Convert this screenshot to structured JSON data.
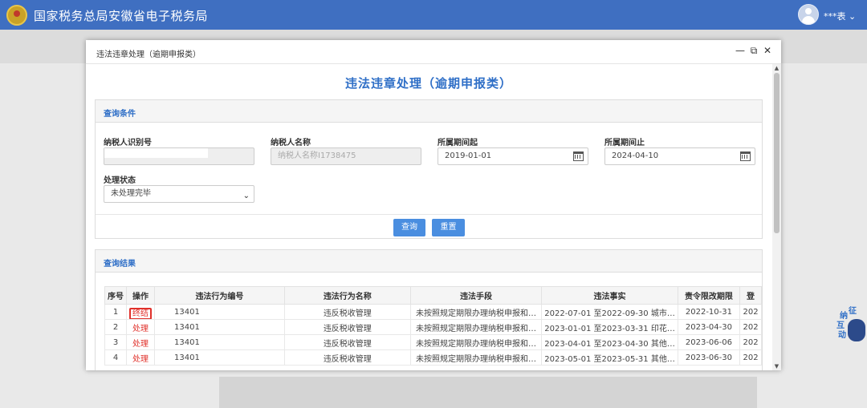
{
  "site": {
    "title": "国家税务总局安徽省电子税务局",
    "username": "***表 ⌄"
  },
  "float_widget": {
    "chars": [
      "纳",
      "征",
      "互",
      "动"
    ]
  },
  "dialog": {
    "window_title": "违法违章处理（逾期申报类）",
    "controls": {
      "minimize": "—",
      "maximize": "⧉",
      "close": "✕"
    },
    "heading": "违法违章处理（逾期申报类）",
    "query": {
      "section_title": "查询条件",
      "taxpayer_id": {
        "label": "纳税人识别号",
        "value": ""
      },
      "taxpayer_name": {
        "label": "纳税人名称",
        "placeholder": "纳税人名称I1738475"
      },
      "period_start": {
        "label": "所属期间起",
        "value": "2019-01-01"
      },
      "period_end": {
        "label": "所属期间止",
        "value": "2024-04-10"
      },
      "status": {
        "label": "处理状态",
        "selected": "未处理完毕"
      },
      "query_button": "查询",
      "reset_button": "重置"
    },
    "results": {
      "section_title": "查询结果",
      "columns": [
        "序号",
        "操作",
        "违法行为编号",
        "违法行为名称",
        "违法手段",
        "违法事实",
        "责令限改期限",
        "登"
      ],
      "rows": [
        {
          "no": "1",
          "action": "终结",
          "code": "13401",
          "name": "违反税收管理",
          "means": "未按照规定期限办理纳税申报和…",
          "fact": "2022-07-01 至2022-09-30 城市…",
          "deadline": "2022-10-31",
          "reg": "202"
        },
        {
          "no": "2",
          "action": "处理",
          "code": "13401",
          "name": "违反税收管理",
          "means": "未按照规定期限办理纳税申报和…",
          "fact": "2023-01-01 至2023-03-31 印花…",
          "deadline": "2023-04-30",
          "reg": "202"
        },
        {
          "no": "3",
          "action": "处理",
          "code": "13401",
          "name": "违反税收管理",
          "means": "未按照规定期限办理纳税申报和…",
          "fact": "2023-04-01 至2023-04-30 其他…",
          "deadline": "2023-06-06",
          "reg": "202"
        },
        {
          "no": "4",
          "action": "处理",
          "code": "13401",
          "name": "违反税收管理",
          "means": "未按照规定期限办理纳税申报和…",
          "fact": "2023-05-01 至2023-05-31 其他…",
          "deadline": "2023-06-30",
          "reg": "202"
        }
      ]
    }
  }
}
